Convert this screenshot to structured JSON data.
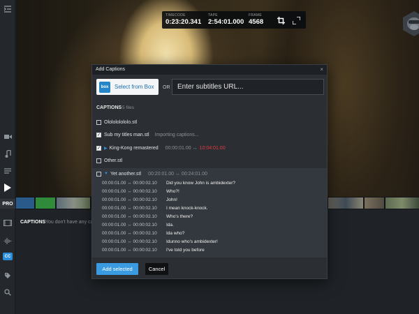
{
  "colors": {
    "accent": "#2b8cd8",
    "danger": "#e23b3b",
    "primary_button": "#3a9be0"
  },
  "sidebar": {
    "items": [
      {
        "icon": "collapse-menu-icon"
      },
      {
        "icon": "video-camera-icon"
      },
      {
        "icon": "music-note-icon"
      },
      {
        "icon": "text-lines-icon"
      },
      {
        "icon": "play-icon"
      },
      {
        "icon": "filmstrip-icon"
      },
      {
        "icon": "audio-waveform-icon"
      },
      {
        "icon": "closed-captions-icon"
      },
      {
        "icon": "tag-icon"
      },
      {
        "icon": "search-icon"
      }
    ],
    "pro_label": "PRO",
    "cc_label": "CC"
  },
  "timecode": {
    "timecode_label": "TIMECODE",
    "timecode_value": "0:23:20.341",
    "tape_label": "TAPE",
    "tape_value": "2:54:01.000",
    "frame_label": "FRAME",
    "frame_value": "4568"
  },
  "captions_panel": {
    "title": "CAPTIONS",
    "empty_text": "You don't have any ca"
  },
  "modal": {
    "title": "Add Captions",
    "close": "×",
    "box_logo": "box",
    "box_button": "Select from Box",
    "or_text": "OR",
    "url_placeholder": "Enter subtitles URL...",
    "files_heading": "CAPTIONS",
    "files_count": "5 files",
    "files": [
      {
        "name": "Ololololololo.stl",
        "checked": false,
        "status": "",
        "time": "",
        "time_end": ""
      },
      {
        "name": "Sub my titles man.stl",
        "checked": true,
        "status": "Importing captions...",
        "time": "",
        "time_end": ""
      },
      {
        "name": "King-Kong remastered",
        "checked": true,
        "status": "",
        "time": "00:00:01.00 ↔",
        "time_end": "10:04:01.00"
      },
      {
        "name": "Other.stl",
        "checked": false,
        "status": "",
        "time": "",
        "time_end": ""
      },
      {
        "name": "Yet another.stl",
        "checked": false,
        "status": "",
        "time": "00:20:01.00 ↔ 00:24:01.00",
        "time_end": ""
      }
    ],
    "cues": [
      {
        "time": "00:00:01.00 ↔ 00:00:02.10",
        "text": "Did you know John is ambidexter?"
      },
      {
        "time": "00:00:01.00 ↔ 00:00:02.10",
        "text": "Who?!"
      },
      {
        "time": "00:00:01.00 ↔ 00:00:02.10",
        "text": "John!"
      },
      {
        "time": "00:00:01.00 ↔ 00:00:02.10",
        "text": "I mean knock-knock."
      },
      {
        "time": "00:00:01.00 ↔ 00:00:02.10",
        "text": "Who's there?"
      },
      {
        "time": "00:00:01.00 ↔ 00:00:02.10",
        "text": "Ida."
      },
      {
        "time": "00:00:01.00 ↔ 00:00:02.10",
        "text": "Ida who?"
      },
      {
        "time": "00:00:01.00 ↔ 00:00:02.10",
        "text": "Idunno who's ambidexter!"
      },
      {
        "time": "00:00:01.00 ↔ 00:00:02.10",
        "text": "I've told you before"
      }
    ],
    "add_button": "Add selected",
    "cancel_button": "Cancel"
  }
}
